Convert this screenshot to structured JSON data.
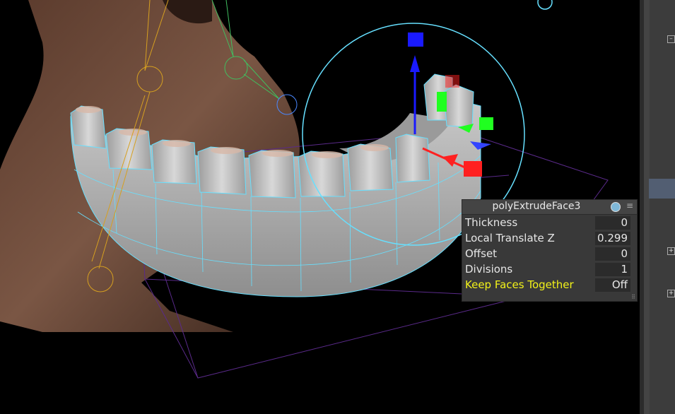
{
  "viewport": {
    "background": "#000000",
    "wire_color": "#66e0ff",
    "manipulator_colors": {
      "x": "#ff2020",
      "y": "#20ff20",
      "z": "#1a1aff"
    }
  },
  "attribute_box": {
    "node_name": "polyExtrudeFace3",
    "node_icon": "extrude-node-icon",
    "menu_icon": "menu-icon",
    "rows": [
      {
        "label": "Thickness",
        "value": "0"
      },
      {
        "label": "Local Translate Z",
        "value": "0.299"
      },
      {
        "label": "Offset",
        "value": "0"
      },
      {
        "label": "Divisions",
        "value": "1"
      },
      {
        "label": "Keep Faces Together",
        "value": "Off",
        "highlight_color": "#f2f219"
      }
    ]
  },
  "right_panel": {
    "expanders": [
      "plus-icon",
      "plus-icon",
      "plus-icon"
    ]
  }
}
